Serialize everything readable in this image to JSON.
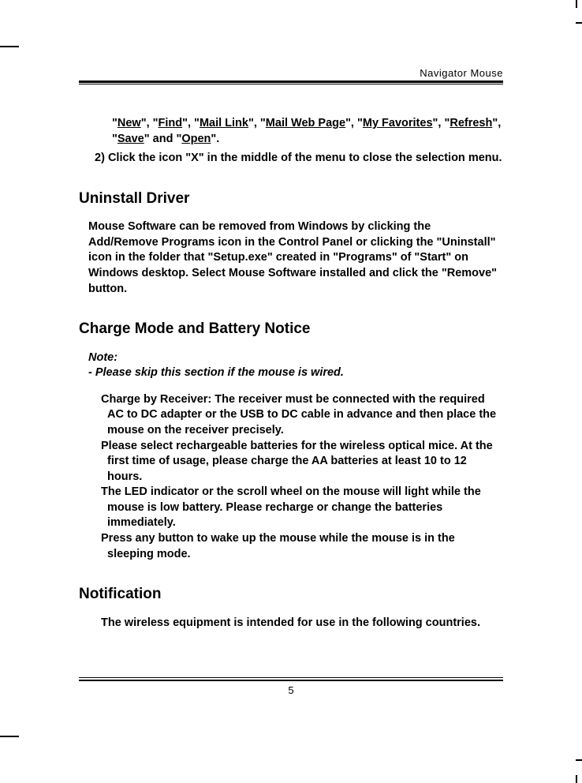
{
  "header": {
    "title": "Navigator Mouse"
  },
  "intro": {
    "links_line1_prefix": "\"",
    "links": {
      "new": "New",
      "find": "Find",
      "mail_link": "Mail Link",
      "mail_web_page": "Mail Web Page",
      "my_favorites": "My Favorites",
      "refresh": "Refresh",
      "save": "Save",
      "open": "Open"
    },
    "step2_label": "2)",
    "step2_text": "Click the icon \"X\" in the middle of the menu to close the selection menu."
  },
  "uninstall": {
    "heading": "Uninstall Driver",
    "body": "Mouse Software can be removed from Windows by clicking the Add/Remove Programs icon in the Control Panel or clicking the \"Uninstall\" icon in the folder that \"Setup.exe\" created in \"Programs\" of \"Start\" on Windows desktop.  Select Mouse Software installed and click the \"Remove\" button."
  },
  "charge": {
    "heading": "Charge Mode and Battery Notice",
    "note_label": "Note:",
    "note_body": "- Please skip this section if the mouse is wired.",
    "items": [
      "Charge by Receiver: The receiver must be connected with the required AC to DC adapter or the USB to DC cable in advance and then place the mouse on the receiver precisely.",
      "Please select rechargeable batteries for the wireless optical mice.  At the first time of usage, please charge the AA batteries at least 10 to 12 hours.",
      "The LED indicator or the scroll wheel on the mouse will light while the mouse is low battery.  Please recharge or change the batteries immediately.",
      "Press any button to wake up the mouse while the mouse is in the sleeping mode."
    ]
  },
  "notification": {
    "heading": "Notification",
    "body": "The wireless equipment is intended for use in the following countries."
  },
  "footer": {
    "page": "5"
  }
}
